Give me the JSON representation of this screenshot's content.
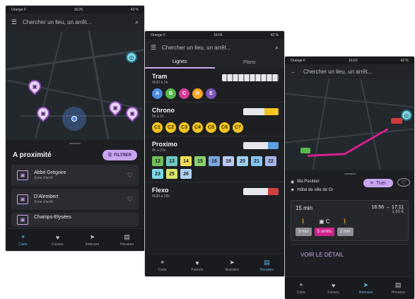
{
  "colors": {
    "accent": "#c8a6ee",
    "route": "#d0208e",
    "active_tab": "#5fb4e8",
    "background": "#1e1f23"
  },
  "tabs": [
    {
      "label": "Carte",
      "icon": "map-pin-icon"
    },
    {
      "label": "Favoris",
      "icon": "heart-icon"
    },
    {
      "label": "Itinéraire",
      "icon": "navigation-arrow-icon"
    },
    {
      "label": "Horaires",
      "icon": "bus-icon"
    }
  ],
  "screen1": {
    "status": {
      "carrier": "Orange F",
      "time": "16:26",
      "battery": "43 %"
    },
    "search_placeholder": "Chercher un lieu, un arrêt...",
    "section_title": "A proximité",
    "filter_label": "FILTRER",
    "stops": [
      {
        "name": "Abbé Grégoire",
        "zone": "Zone d'arrêt"
      },
      {
        "name": "D'Alembert",
        "zone": "Zone d'arrêt"
      },
      {
        "name": "Champs-Elysées",
        "zone": ""
      }
    ]
  },
  "screen2": {
    "status": {
      "carrier": "Orange F",
      "time": "16:54",
      "battery": "42 %"
    },
    "search_placeholder": "Chercher un lieu, un arrêt...",
    "subtabs": [
      "Lignes",
      "Plans"
    ],
    "modes": [
      {
        "name": "Tram",
        "hours": "4h30 à 1h",
        "lines": [
          {
            "label": "A",
            "color": "#4a90e2",
            "text": "#ffffff"
          },
          {
            "label": "B",
            "color": "#59b84c",
            "text": "#ffffff"
          },
          {
            "label": "C",
            "color": "#d43c9a",
            "text": "#ffffff"
          },
          {
            "label": "D",
            "color": "#f5a623",
            "text": "#ffffff"
          },
          {
            "label": "E",
            "color": "#7b57b8",
            "text": "#ffffff"
          }
        ]
      },
      {
        "name": "Chrono",
        "hours": "5h à 1h",
        "lines": [
          {
            "label": "C1",
            "color": "#f2c522",
            "text": "#3a3000"
          },
          {
            "label": "C2",
            "color": "#f2c522",
            "text": "#3a3000"
          },
          {
            "label": "C3",
            "color": "#f2c522",
            "text": "#3a3000"
          },
          {
            "label": "C4",
            "color": "#f2c522",
            "text": "#3a3000"
          },
          {
            "label": "C5",
            "color": "#f2c522",
            "text": "#3a3000"
          },
          {
            "label": "C6",
            "color": "#f2c522",
            "text": "#3a3000"
          },
          {
            "label": "C7",
            "color": "#f2c522",
            "text": "#3a3000"
          }
        ]
      },
      {
        "name": "Proximo",
        "hours": "6h à 21h",
        "lines": [
          {
            "label": "12",
            "color": "#6fbf5a"
          },
          {
            "label": "13",
            "color": "#6ec9c2"
          },
          {
            "label": "14",
            "color": "#f0e05a"
          },
          {
            "label": "15",
            "color": "#8ad06a"
          },
          {
            "label": "16",
            "color": "#7aa6e0"
          },
          {
            "label": "19",
            "color": "#b8c8f0"
          },
          {
            "label": "20",
            "color": "#9fd0f0"
          },
          {
            "label": "21",
            "color": "#82c6f2"
          },
          {
            "label": "22",
            "color": "#a7b6ee"
          },
          {
            "label": "23",
            "color": "#7fd8e6"
          },
          {
            "label": "25",
            "color": "#d8e86a"
          },
          {
            "label": "26",
            "color": "#b0d4f4"
          }
        ]
      },
      {
        "name": "Flexo",
        "hours": "6h30 à 20h",
        "lines": []
      }
    ]
  },
  "screen3": {
    "status": {
      "carrier": "Orange F",
      "time": "16:53",
      "battery": "43 %"
    },
    "search_placeholder": "Chercher un lieu, un arrêt...",
    "from": "Ma Position",
    "to": "Hôtel de ville de Gr",
    "sort_label": "Trier",
    "result": {
      "duration": "15 min",
      "times": "16:56 → 17:11",
      "price": "1,60 €",
      "steps": [
        {
          "icon": "walk-icon",
          "chip": "3 min"
        },
        {
          "icon": "tram-icon",
          "line": "C",
          "chip": "5 arrêts"
        },
        {
          "icon": "walk-icon",
          "chip": "2 min"
        }
      ]
    },
    "detail_label": "VOIR LE DÉTAIL"
  }
}
